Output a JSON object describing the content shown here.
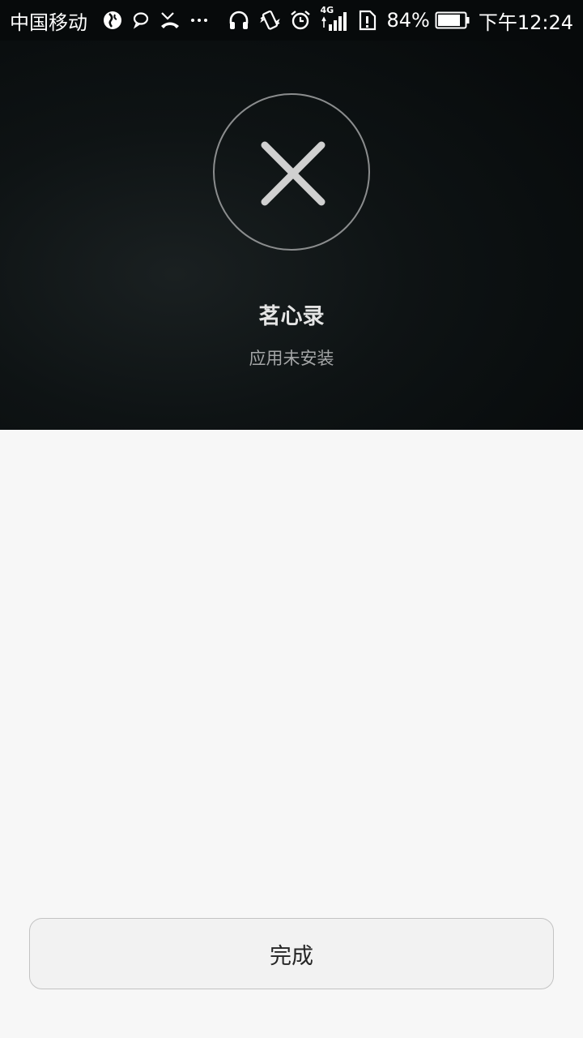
{
  "status_bar": {
    "carrier": "中国移动",
    "network_type": "4G",
    "battery_percent": "84%",
    "time": "下午12:24",
    "icons": [
      "globe-icon",
      "chat-bubble-icon",
      "missed-call-icon",
      "more-dots-icon",
      "headphones-icon",
      "vibrate-icon",
      "alarm-icon",
      "signal-icon",
      "sim-alert-icon",
      "battery-icon"
    ]
  },
  "result": {
    "icon": "close-icon",
    "app_name": "茗心录",
    "message": "应用未安装"
  },
  "footer": {
    "done_label": "完成"
  },
  "colors": {
    "header_bg": "#070a0b",
    "content_bg": "#f7f7f7",
    "button_bg": "#f2f2f2",
    "button_border": "#c3c3c3"
  }
}
